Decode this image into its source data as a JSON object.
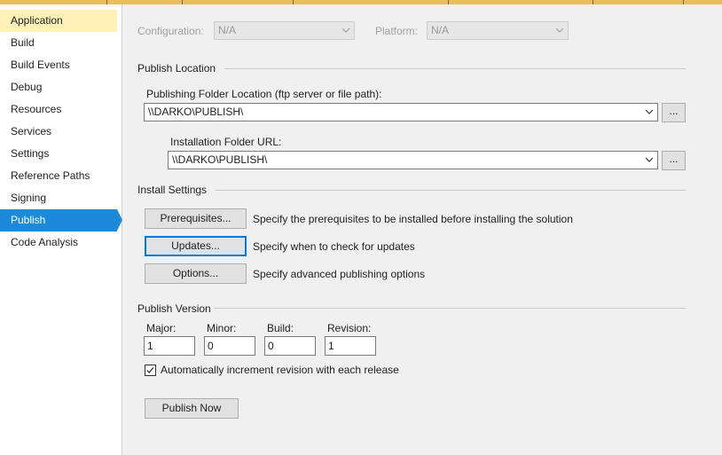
{
  "sidebar": {
    "items": [
      {
        "label": "Application"
      },
      {
        "label": "Build"
      },
      {
        "label": "Build Events"
      },
      {
        "label": "Debug"
      },
      {
        "label": "Resources"
      },
      {
        "label": "Services"
      },
      {
        "label": "Settings"
      },
      {
        "label": "Reference Paths"
      },
      {
        "label": "Signing"
      },
      {
        "label": "Publish"
      },
      {
        "label": "Code Analysis"
      }
    ],
    "active": "Publish"
  },
  "config_bar": {
    "configuration_label": "Configuration:",
    "configuration_value": "N/A",
    "platform_label": "Platform:",
    "platform_value": "N/A"
  },
  "publish_location": {
    "heading": "Publish Location",
    "folder_label": "Publishing Folder Location (ftp server or file path):",
    "folder_value": "\\\\DARKO\\PUBLISH\\",
    "install_label": "Installation Folder URL:",
    "install_value": "\\\\DARKO\\PUBLISH\\",
    "browse_label": "..."
  },
  "install_settings": {
    "heading": "Install Settings",
    "rows": [
      {
        "button": "Prerequisites...",
        "description": "Specify the prerequisites to be installed before installing the solution"
      },
      {
        "button": "Updates...",
        "description": "Specify when to check for updates"
      },
      {
        "button": "Options...",
        "description": "Specify advanced publishing options"
      }
    ]
  },
  "publish_version": {
    "heading": "Publish Version",
    "major_label": "Major:",
    "major_value": "1",
    "minor_label": "Minor:",
    "minor_value": "0",
    "build_label": "Build:",
    "build_value": "0",
    "revision_label": "Revision:",
    "revision_value": "1",
    "auto_increment_label": "Automatically increment revision with each release",
    "auto_increment_checked": true
  },
  "publish_now_label": "Publish Now",
  "icons": {
    "combo_arrow": "chevron-down-icon",
    "checkbox_mark": "checkmark-icon"
  },
  "colors": {
    "active_nav": "#1c8ad9",
    "first_nav": "#fff0b8",
    "focus": "#0078d7"
  }
}
